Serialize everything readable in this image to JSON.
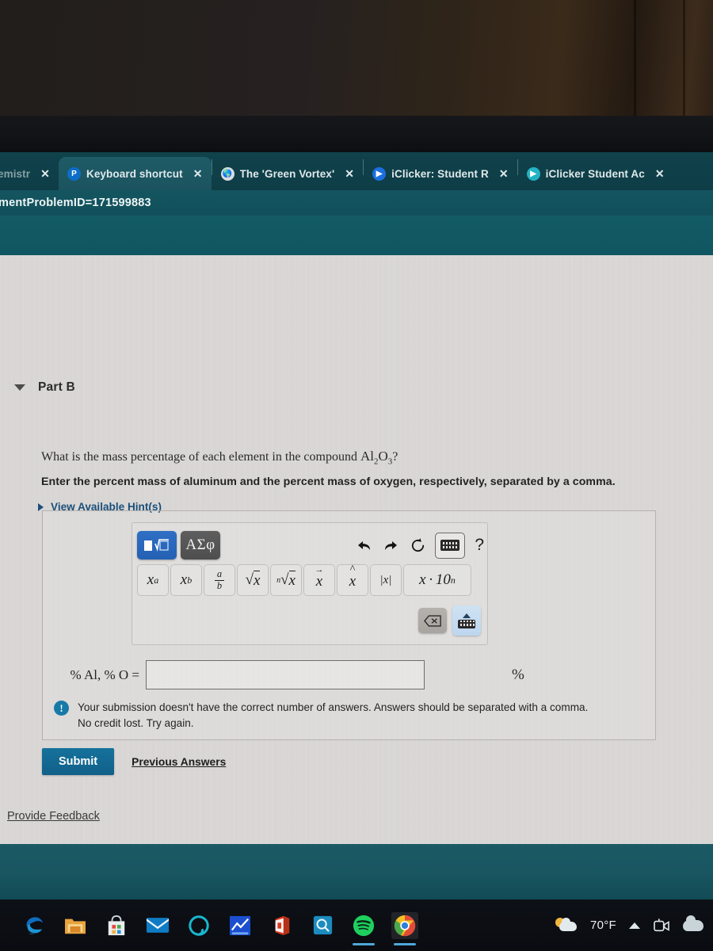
{
  "browser": {
    "tabs": [
      {
        "title": "emistr",
        "favicon": "cutoff-favicon",
        "active": false,
        "truncated": true,
        "close_label": "✕"
      },
      {
        "title": "Keyboard shortcut",
        "favicon": "pearson-icon",
        "active": true,
        "truncated": true,
        "close_label": "✕"
      },
      {
        "title": "The 'Green Vortex'",
        "favicon": "globe-icon",
        "active": false,
        "truncated": true,
        "close_label": "✕"
      },
      {
        "title": "iClicker: Student R",
        "favicon": "iclicker-blue-icon",
        "active": false,
        "truncated": true,
        "close_label": "✕"
      },
      {
        "title": "iClicker Student Ac",
        "favicon": "iclicker-teal-icon",
        "active": false,
        "truncated": true,
        "close_label": "✕"
      }
    ],
    "url": "mentProblemID=171599883"
  },
  "page": {
    "part": {
      "caret_icon": "chevron-down-icon",
      "title": "Part B"
    },
    "question": {
      "text_before": "What is the mass percentage of each element in the compound",
      "formula_base1": "Al",
      "formula_sub1": "2",
      "formula_base2": "O",
      "formula_sub2": "3",
      "text_after": "?"
    },
    "instruction": "Enter the percent mass of aluminum and the percent mass of oxygen, respectively, separated by a comma.",
    "hints": {
      "caret_icon": "chevron-right-icon",
      "label": "View Available Hint(s)"
    },
    "mathpad": {
      "template_button": {
        "name": "template-mode-button",
        "glyph": "■√□"
      },
      "greek_button": {
        "name": "greek-symbols-button",
        "label": "ΑΣφ"
      },
      "undo_icon": "undo-icon",
      "undo_glyph": "↩",
      "redo_icon": "redo-icon",
      "redo_glyph": "↪",
      "reset_icon": "reset-icon",
      "reset_glyph": "↻",
      "keyboard_icon": "keyboard-icon",
      "help_label": "?",
      "symbols": [
        {
          "name": "superscript-button",
          "display": "x^a"
        },
        {
          "name": "subscript-button",
          "display": "x_b"
        },
        {
          "name": "fraction-button",
          "display": "a/b",
          "num": "a",
          "den": "b"
        },
        {
          "name": "square-root-button",
          "display": "√x"
        },
        {
          "name": "nth-root-button",
          "display": "ⁿ√x"
        },
        {
          "name": "vector-button",
          "display": "x⃗"
        },
        {
          "name": "unit-vector-button",
          "display": "x̂"
        },
        {
          "name": "absolute-value-button",
          "display": "|x|"
        },
        {
          "name": "scientific-notation-button",
          "display": "x · 10ⁿ"
        }
      ],
      "backspace_icon": "backspace-icon",
      "backspace_glyph": "⌫",
      "keyboard_toggle_icon": "keyboard-collapse-icon"
    },
    "answer": {
      "label": "% Al, % O =",
      "value": "",
      "placeholder": "",
      "unit": "%"
    },
    "feedback": {
      "icon": "exclamation-icon",
      "icon_glyph": "!",
      "line1": "Your submission doesn't have the correct number of answers. Answers should be separated with a comma.",
      "line2": "No credit lost. Try again."
    },
    "actions": {
      "submit_label": "Submit",
      "previous_answers_label": "Previous Answers"
    },
    "provide_feedback_label": "Provide Feedback"
  },
  "taskbar": {
    "icons": [
      {
        "name": "edge-icon",
        "label": "Microsoft Edge"
      },
      {
        "name": "file-explorer-icon",
        "label": "File Explorer"
      },
      {
        "name": "microsoft-store-icon",
        "label": "Microsoft Store"
      },
      {
        "name": "mail-icon",
        "label": "Mail"
      },
      {
        "name": "alexa-icon",
        "label": "Alexa"
      },
      {
        "name": "blue-app-icon",
        "label": "App"
      },
      {
        "name": "office-icon",
        "label": "Office"
      },
      {
        "name": "search-app-icon",
        "label": "Search"
      },
      {
        "name": "spotify-icon",
        "label": "Spotify"
      },
      {
        "name": "chrome-icon",
        "label": "Google Chrome"
      }
    ],
    "tray": {
      "weather_icon": "weather-partly-cloudy-icon",
      "temperature": "70°F",
      "chevron_icon": "chevron-up-icon",
      "meeting_icon": "meet-now-icon",
      "cloud_icon": "onedrive-icon"
    }
  },
  "colors": {
    "browser_teal": "#14545f",
    "active_tab": "#1e5b66",
    "page_bg": "#d8d6d4",
    "submit_blue": "#16729c",
    "link_blue": "#1b4f7a",
    "feedback_blue": "#1779a8",
    "mathpad_primary": "#2f6fc4"
  }
}
